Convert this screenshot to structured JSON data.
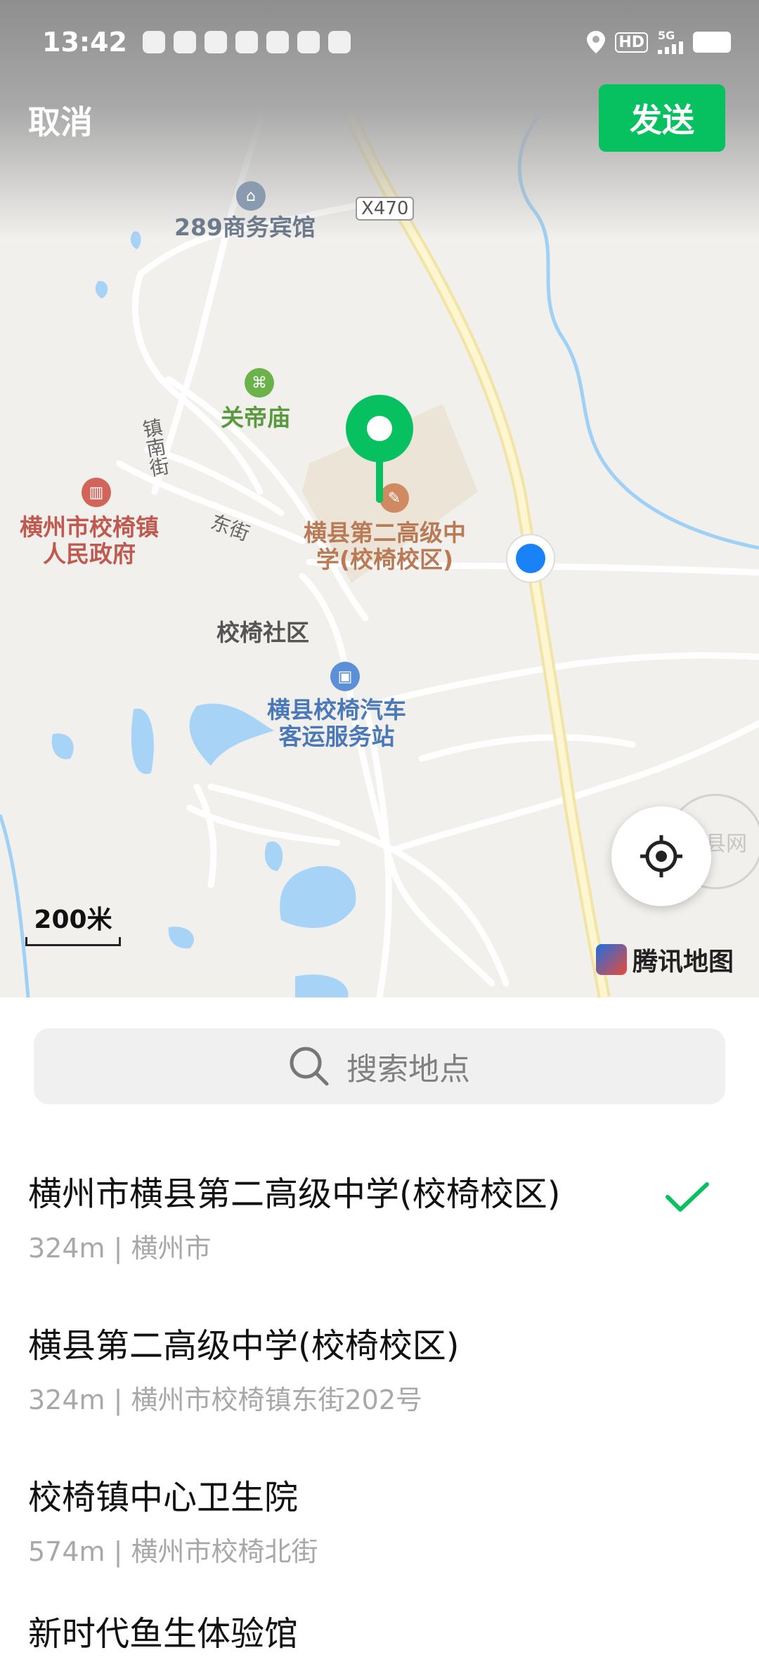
{
  "status_bar": {
    "time": "13:42",
    "network_label": "5G",
    "hd_label": "HD",
    "icons": [
      "k-icon",
      "baidu-cloud-icon",
      "tiktok-icon",
      "baidu-icon",
      "app-icon",
      "message-icon",
      "camera-icon",
      "location-icon",
      "hd-icon",
      "signal-icon",
      "battery-icon"
    ]
  },
  "header": {
    "cancel_label": "取消",
    "send_label": "发送",
    "send_color": "#07c160"
  },
  "map": {
    "pois": [
      {
        "name": "289商务宾馆",
        "color": "#6c7a8c",
        "icon": "hotel-icon"
      },
      {
        "name": "关帝庙",
        "color": "#5a9a3e",
        "icon": "temple-icon"
      },
      {
        "name": "横州市校椅镇\n人民政府",
        "color": "#c05a50",
        "icon": "government-icon"
      },
      {
        "name": "横县第二高级中\n学(校椅校区)",
        "color": "#b97a55",
        "icon": "school-icon"
      },
      {
        "name": "校椅社区",
        "color": "#555555",
        "icon": ""
      },
      {
        "name": "横县校椅汽车\n客运服务站",
        "color": "#4a78b8",
        "icon": "bus-station-icon"
      }
    ],
    "road_labels": [
      "X470",
      "镇南街",
      "东街"
    ],
    "scale_label": "200米",
    "brand": "腾讯地图",
    "watermark": "横县网",
    "pin_color": "#07c160",
    "my_location_color": "#1a82f7"
  },
  "search": {
    "placeholder": "搜索地点"
  },
  "results": [
    {
      "name": "横州市横县第二高级中学(校椅校区)",
      "addr": "324m | 横州市",
      "selected": true
    },
    {
      "name": "横县第二高级中学(校椅校区)",
      "addr": "324m | 横州市校椅镇东街202号",
      "selected": false
    },
    {
      "name": "校椅镇中心卫生院",
      "addr": "574m | 横州市校椅北街",
      "selected": false
    },
    {
      "name": "新时代鱼生体验馆",
      "addr": "",
      "selected": false
    }
  ]
}
